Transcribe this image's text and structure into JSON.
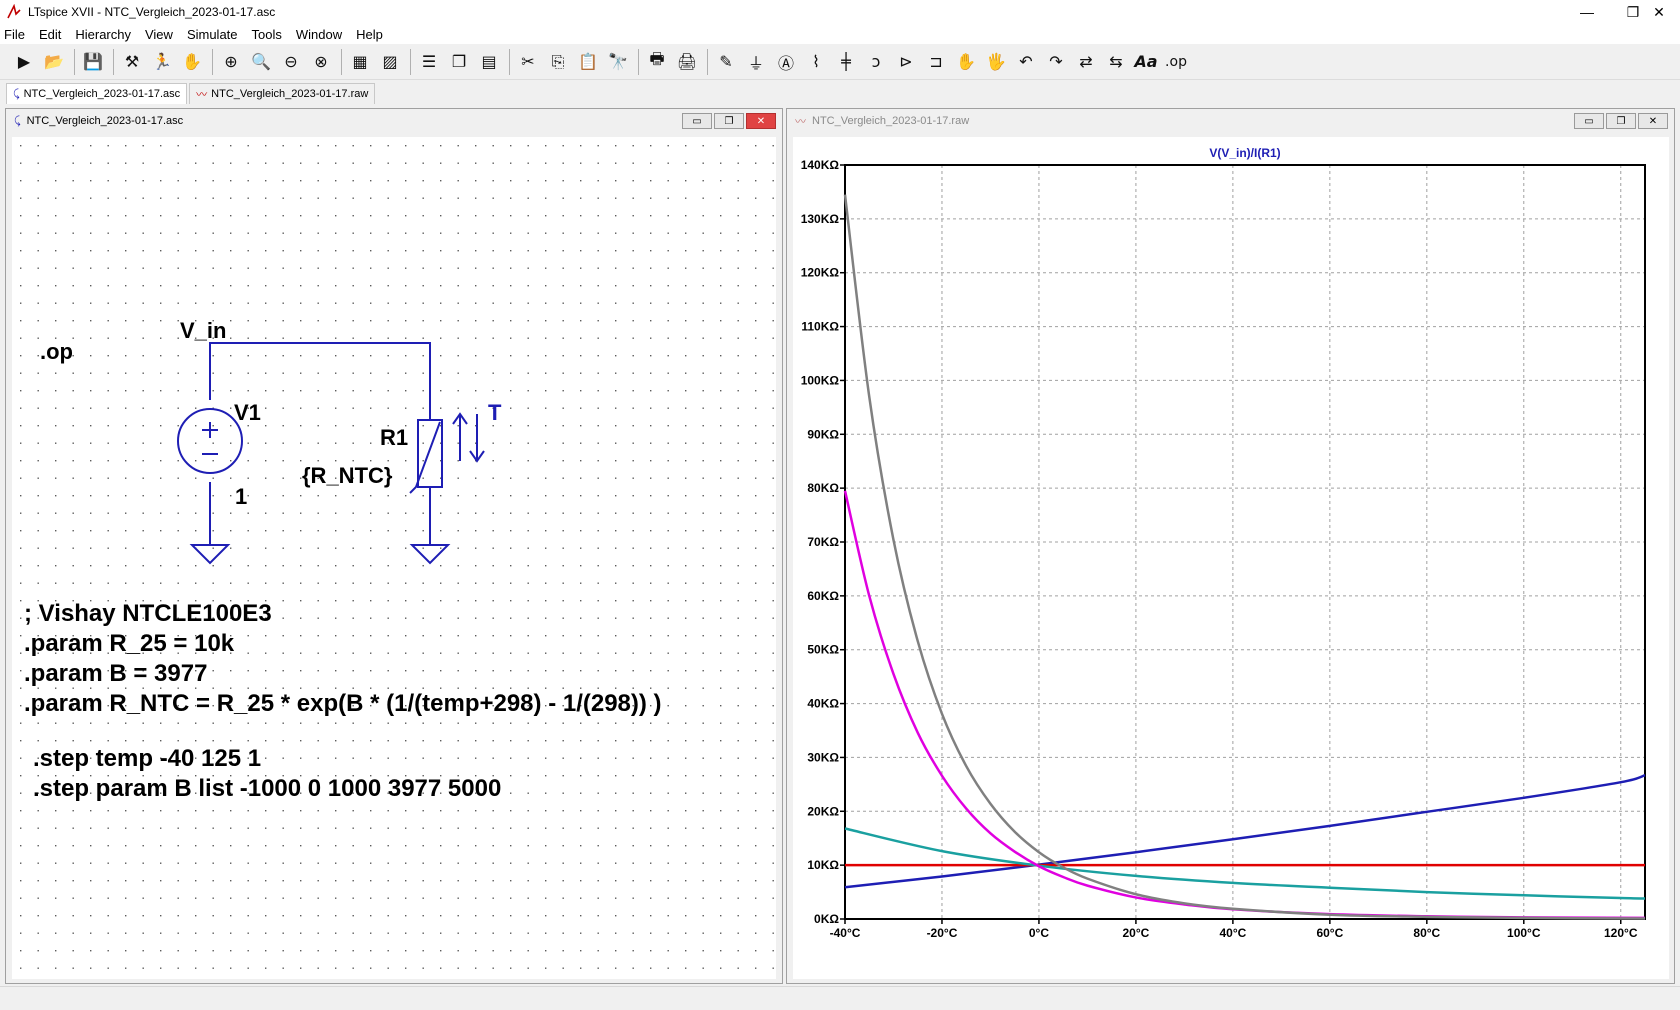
{
  "window": {
    "title": "LTspice XVII - NTC_Vergleich_2023-01-17.asc"
  },
  "window_controls": {
    "minimize": "—",
    "restore": "❐",
    "close": "✕"
  },
  "menu": [
    "File",
    "Edit",
    "Hierarchy",
    "View",
    "Simulate",
    "Tools",
    "Window",
    "Help"
  ],
  "tabs": [
    {
      "label": "NTC_Vergleich_2023-01-17.asc",
      "icon": "schematic-icon",
      "active": true
    },
    {
      "label": "NTC_Vergleich_2023-01-17.raw",
      "icon": "waveform-icon",
      "active": false
    }
  ],
  "toolbar": {
    "op_label": ".op",
    "font_label": "Aa"
  },
  "schematic_window": {
    "title": "NTC_Vergleich_2023-01-17.asc",
    "op_directive": ".op",
    "net_label": "V_in",
    "v1_name": "V1",
    "v1_value": "1",
    "r1_name": "R1",
    "r1_value": "{R_NTC}",
    "r1_param": "T",
    "comment": "; Vishay NTCLE100E3",
    "param1": ".param R_25 = 10k",
    "param2": ".param B = 3977",
    "param3": ".param R_NTC = R_25 * exp(B * (1/(temp+298) - 1/(298)) )",
    "step1": ".step temp -40 125 1",
    "step2": ".step param B list -1000 0 1000 3977 5000",
    "wire_color": "#1e1eb4",
    "component_color": "#1e1eb4"
  },
  "waveform_window": {
    "title": "NTC_Vergleich_2023-01-17.raw"
  },
  "chart_data": {
    "type": "line",
    "title": "V(V_in)/I(R1)",
    "xlabel": "",
    "ylabel": "",
    "xlim": [
      -40,
      125
    ],
    "ylim": [
      0,
      140
    ],
    "x_ticks": [
      "-40°C",
      "-20°C",
      "0°C",
      "20°C",
      "40°C",
      "60°C",
      "80°C",
      "100°C",
      "120°C"
    ],
    "x_tick_values": [
      -40,
      -20,
      0,
      20,
      40,
      60,
      80,
      100,
      120
    ],
    "y_ticks": [
      "0KΩ",
      "10KΩ",
      "20KΩ",
      "30KΩ",
      "40KΩ",
      "50KΩ",
      "60KΩ",
      "70KΩ",
      "80KΩ",
      "90KΩ",
      "100KΩ",
      "110KΩ",
      "120KΩ",
      "130KΩ",
      "140KΩ"
    ],
    "y_tick_values": [
      0,
      10,
      20,
      30,
      40,
      50,
      60,
      70,
      80,
      90,
      100,
      110,
      120,
      130,
      140
    ],
    "grid": true,
    "series": [
      {
        "color": "#1e1eb4",
        "x": [
          -40,
          -20,
          0,
          20,
          40,
          60,
          80,
          100,
          120,
          125
        ],
        "values": [
          5.9,
          7.9,
          10.1,
          12.4,
          14.8,
          17.3,
          19.9,
          22.5,
          25.4,
          26.7
        ]
      },
      {
        "color": "#e00000",
        "x": [
          -40,
          0,
          125
        ],
        "values": [
          10,
          10,
          10
        ]
      },
      {
        "color": "#1aa0a0",
        "x": [
          -40,
          -20,
          0,
          20,
          40,
          60,
          80,
          100,
          120,
          125
        ],
        "values": [
          16.8,
          12.6,
          9.9,
          8.0,
          6.7,
          5.8,
          5.0,
          4.4,
          3.9,
          3.8
        ]
      },
      {
        "color": "#e000e0",
        "x": [
          -40,
          -35,
          -30,
          -25,
          -20,
          -15,
          -10,
          -5,
          0,
          5,
          10,
          20,
          30,
          40,
          60,
          80,
          100,
          125
        ],
        "values": [
          79.5,
          60.0,
          45.5,
          34.6,
          26.6,
          20.5,
          15.9,
          12.5,
          9.8,
          7.8,
          6.2,
          4.0,
          2.7,
          1.8,
          0.9,
          0.5,
          0.3,
          0.2
        ]
      },
      {
        "color": "#808080",
        "x": [
          -40,
          -35,
          -30,
          -25,
          -20,
          -15,
          -10,
          -5,
          0,
          5,
          10,
          20,
          30,
          40,
          60,
          80,
          100,
          125
        ],
        "values": [
          134.5,
          97.0,
          70.4,
          51.6,
          38.1,
          28.4,
          21.4,
          16.2,
          12.4,
          9.6,
          7.5,
          4.6,
          2.9,
          1.9,
          0.8,
          0.4,
          0.2,
          0.1
        ]
      }
    ]
  }
}
